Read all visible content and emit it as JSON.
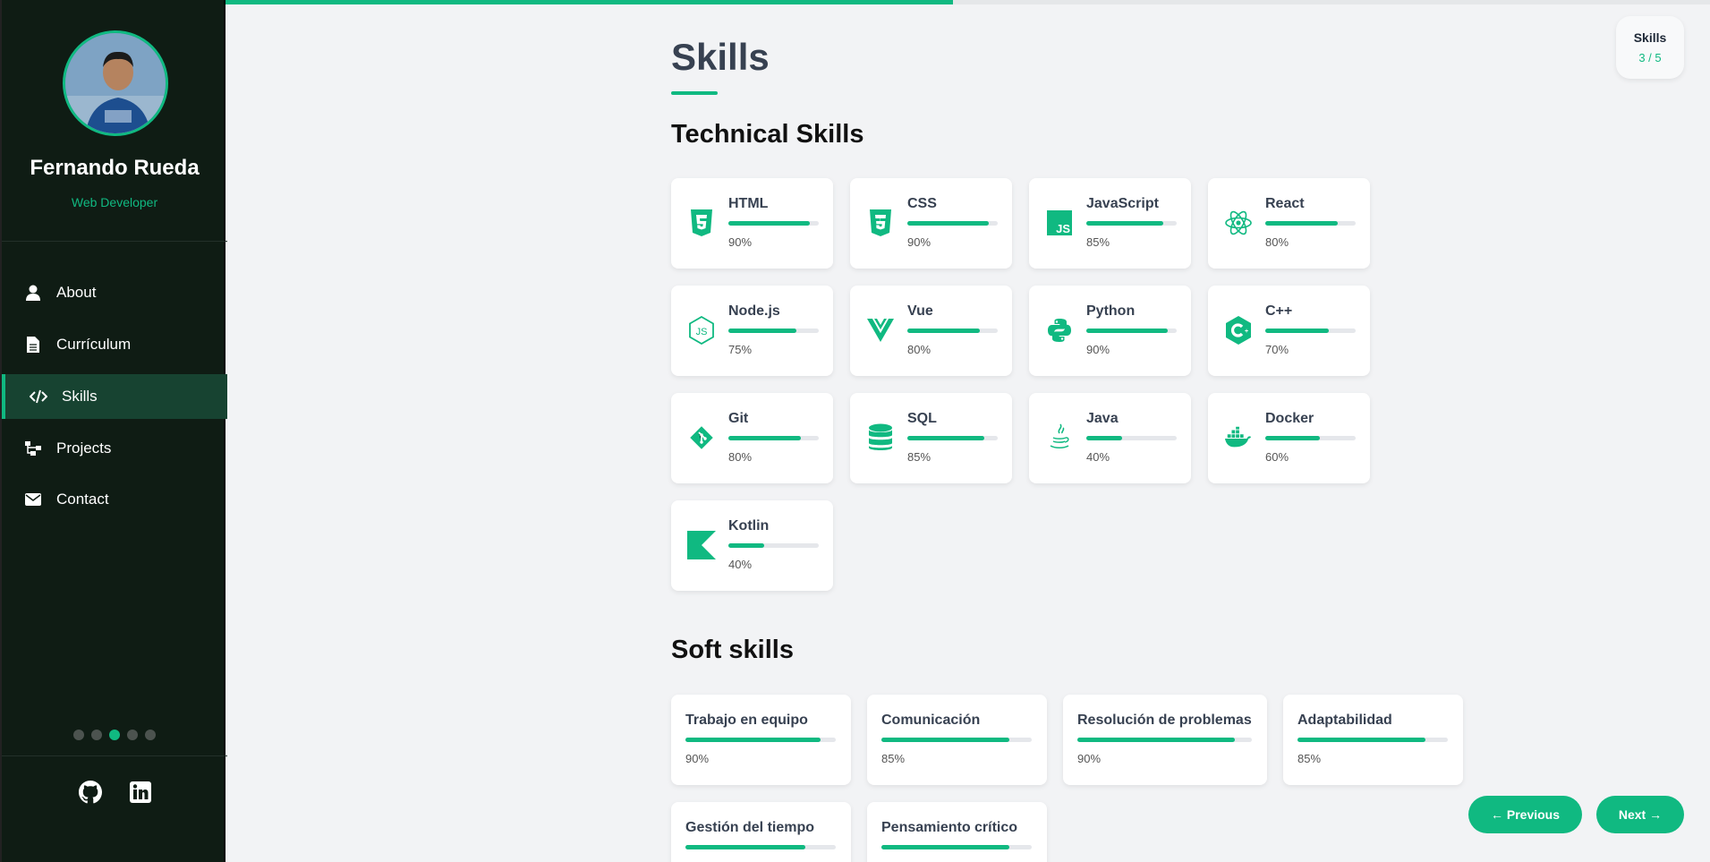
{
  "profile": {
    "name": "Fernando Rueda",
    "role": "Web Developer"
  },
  "nav": [
    {
      "label": "About",
      "icon": "user-icon"
    },
    {
      "label": "Currículum",
      "icon": "document-icon"
    },
    {
      "label": "Skills",
      "icon": "code-icon",
      "active": true
    },
    {
      "label": "Projects",
      "icon": "sitemap-icon"
    },
    {
      "label": "Contact",
      "icon": "envelope-icon"
    }
  ],
  "slides": {
    "current": 3,
    "total": 5
  },
  "progress_percent": 0.49,
  "badge": {
    "title": "Skills",
    "count": "3 / 5"
  },
  "page_title": "Skills",
  "technical_title": "Technical Skills",
  "soft_title": "Soft skills",
  "technical": [
    {
      "label": "HTML",
      "pct": "90%",
      "value": 90,
      "icon": "html5-icon"
    },
    {
      "label": "CSS",
      "pct": "90%",
      "value": 90,
      "icon": "css3-icon"
    },
    {
      "label": "JavaScript",
      "pct": "85%",
      "value": 85,
      "icon": "javascript-icon"
    },
    {
      "label": "React",
      "pct": "80%",
      "value": 80,
      "icon": "react-icon"
    },
    {
      "label": "Node.js",
      "pct": "75%",
      "value": 75,
      "icon": "nodejs-icon"
    },
    {
      "label": "Vue",
      "pct": "80%",
      "value": 80,
      "icon": "vue-icon"
    },
    {
      "label": "Python",
      "pct": "90%",
      "value": 90,
      "icon": "python-icon"
    },
    {
      "label": "C++",
      "pct": "70%",
      "value": 70,
      "icon": "cplusplus-icon"
    },
    {
      "label": "Git",
      "pct": "80%",
      "value": 80,
      "icon": "git-icon"
    },
    {
      "label": "SQL",
      "pct": "85%",
      "value": 85,
      "icon": "database-icon"
    },
    {
      "label": "Java",
      "pct": "40%",
      "value": 40,
      "icon": "java-icon"
    },
    {
      "label": "Docker",
      "pct": "60%",
      "value": 60,
      "icon": "docker-icon"
    },
    {
      "label": "Kotlin",
      "pct": "40%",
      "value": 40,
      "icon": "kotlin-icon"
    }
  ],
  "soft": [
    {
      "label": "Trabajo en equipo",
      "pct": "90%",
      "value": 90
    },
    {
      "label": "Comunicación",
      "pct": "85%",
      "value": 85
    },
    {
      "label": "Resolución de problemas",
      "pct": "90%",
      "value": 90
    },
    {
      "label": "Adaptabilidad",
      "pct": "85%",
      "value": 85
    },
    {
      "label": "Gestión del tiempo",
      "pct": "",
      "value": 80
    },
    {
      "label": "Pensamiento crítico",
      "pct": "",
      "value": 85
    }
  ],
  "buttons": {
    "previous": "← Previous",
    "next": "Next →"
  },
  "social": [
    "github-icon",
    "linkedin-icon"
  ],
  "colors": {
    "accent": "#10b981",
    "sidebar": "#0f1c14",
    "active_item": "#174331"
  }
}
